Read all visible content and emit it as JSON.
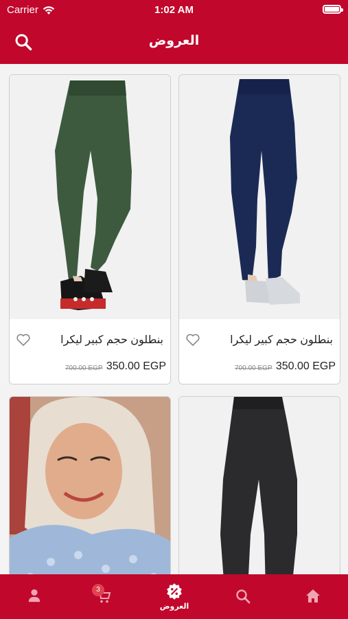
{
  "status_bar": {
    "carrier": "Carrier",
    "time": "1:02 AM"
  },
  "header": {
    "title": "العروض"
  },
  "products": [
    {
      "name": "بنطلون حجم كبير ليكرا",
      "old_price": "700.00 EGP",
      "price": "350.00 EGP",
      "image": "dark-green-denim-leggings"
    },
    {
      "name": "بنطلون حجم كبير ليكرا",
      "old_price": "700.00 EGP",
      "price": "350.00 EGP",
      "image": "navy-denim-leggings"
    },
    {
      "name": "",
      "old_price": "",
      "price": "",
      "image": "woman-in-beige-hijab"
    },
    {
      "name": "",
      "old_price": "",
      "price": "",
      "image": "black-denim-leggings"
    }
  ],
  "tabbar": {
    "cart_badge": "3",
    "offers_label": "العروض"
  },
  "colors": {
    "brand": "#c1072c",
    "background": "#f3f3f3"
  }
}
